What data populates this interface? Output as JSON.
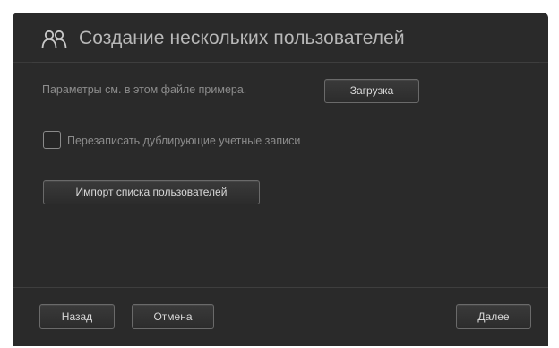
{
  "dialog": {
    "title": "Создание нескольких пользователей",
    "header_icon": "users-icon",
    "info_text": "Параметры см. в этом файле примера.",
    "load_button": "Загрузка",
    "overwrite_checkbox": {
      "label": "Перезаписать дублирующие учетные записи",
      "checked": false
    },
    "import_button": "Импорт списка пользователей"
  },
  "footer": {
    "back_button": "Назад",
    "cancel_button": "Отмена",
    "next_button": "Далее"
  },
  "colors": {
    "dialog_background": "#2a2a2a",
    "title_text": "#b8b8b8",
    "secondary_text": "#8c8c8c",
    "button_border": "#6a6a6a",
    "button_text": "#d8d8d8"
  }
}
